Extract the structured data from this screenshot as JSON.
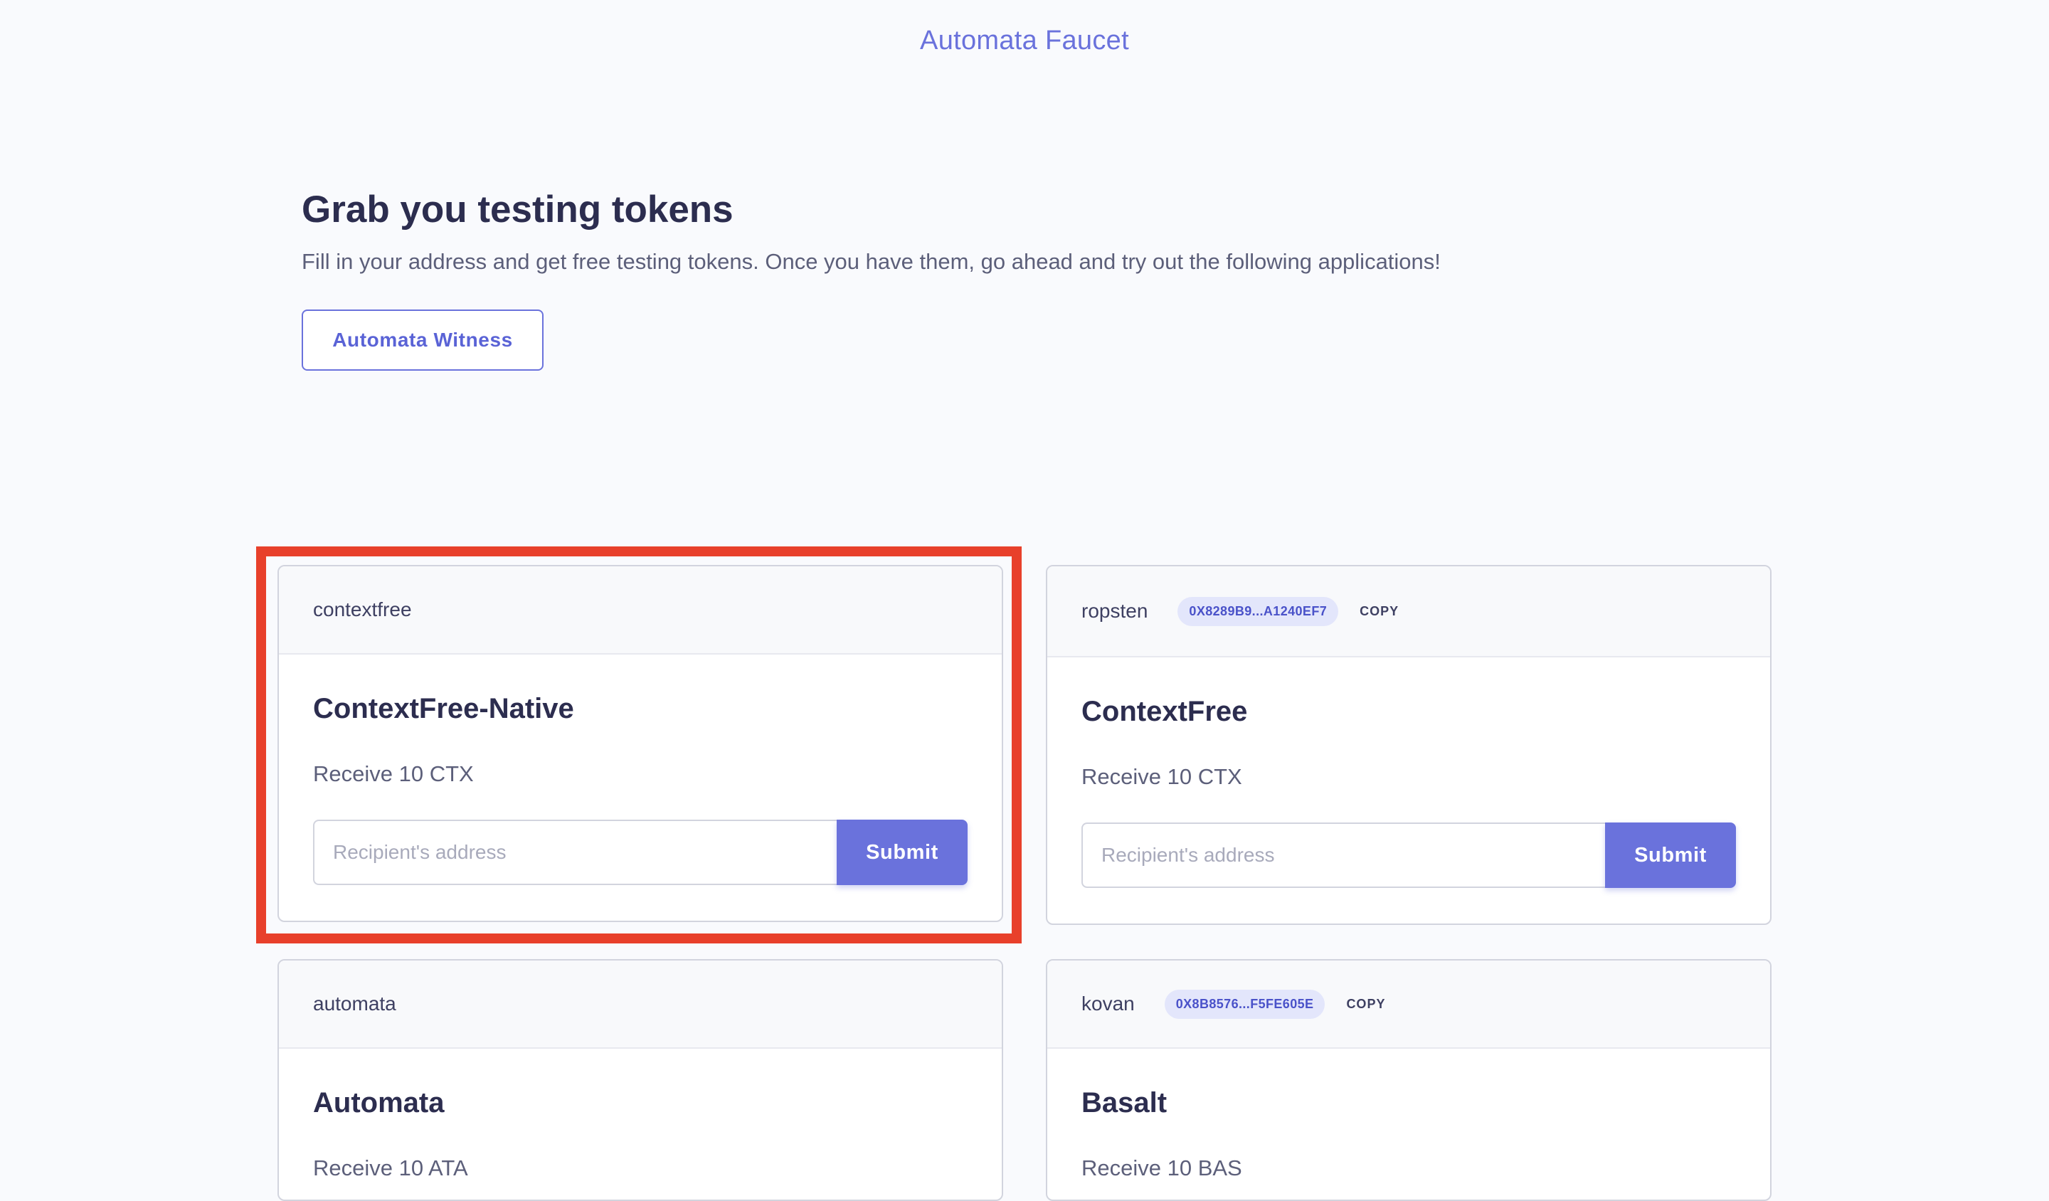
{
  "header": {
    "title": "Automata Faucet"
  },
  "hero": {
    "title": "Grab you testing tokens",
    "description": "Fill in your address and get free testing tokens. Once you have them, go ahead and try out the following applications!",
    "button_label": "Automata Witness"
  },
  "colors": {
    "accent": "#6a72dc",
    "highlight": "#e8402b",
    "badge_bg": "#e3e6fb"
  },
  "cards": [
    {
      "network": "contextfree",
      "token_name": "ContextFree-Native",
      "receive_text": "Receive 10 CTX",
      "input_placeholder": "Recipient's address",
      "submit_label": "Submit"
    },
    {
      "network": "ropsten",
      "address_badge": "0X8289B9...A1240EF7",
      "copy_label": "COPY",
      "token_name": "ContextFree",
      "receive_text": "Receive 10 CTX",
      "input_placeholder": "Recipient's address",
      "submit_label": "Submit"
    },
    {
      "network": "automata",
      "token_name": "Automata",
      "receive_text": "Receive 10 ATA"
    },
    {
      "network": "kovan",
      "address_badge": "0X8B8576...F5FE605E",
      "copy_label": "COPY",
      "token_name": "Basalt",
      "receive_text": "Receive 10 BAS"
    }
  ]
}
